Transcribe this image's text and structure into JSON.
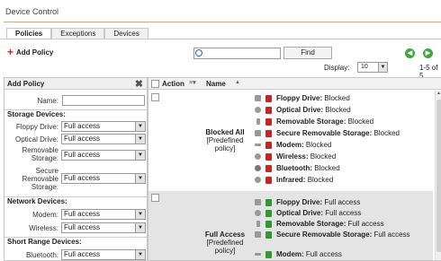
{
  "window": {
    "title": "Device Control"
  },
  "tabs": [
    {
      "label": "Policies",
      "active": true
    },
    {
      "label": "Exceptions"
    },
    {
      "label": "Devices"
    }
  ],
  "toolbar": {
    "add_policy_label": "Add Policy",
    "search_value": "",
    "find_label": "Find",
    "display_label": "Display:",
    "display_value": "10",
    "pager_text": "1-5 of 5"
  },
  "add_policy_panel": {
    "title": "Add Policy",
    "name_label": "Name:",
    "name_value": "",
    "storage_title": "Storage Devices:",
    "network_title": "Network Devices:",
    "short_range_title": "Short Range Devices:",
    "fields": [
      {
        "label": "Floppy Drive:",
        "value": "Full access"
      },
      {
        "label": "Optical Drive:",
        "value": "Full access"
      },
      {
        "label": "Removable Storage:",
        "value": "Full access"
      },
      {
        "label": "Secure Removable Storage:",
        "value": "Full access"
      },
      {
        "label": "Modem:",
        "value": "Full access"
      },
      {
        "label": "Wireless:",
        "value": "Full access"
      },
      {
        "label": "Bluetooth:",
        "value": "Full access"
      }
    ]
  },
  "table": {
    "headers": {
      "action": "Action",
      "name": "Name"
    },
    "rows": [
      {
        "name": "Blocked All",
        "subtitle": "[Predefined policy]",
        "devices": [
          {
            "name": "Floppy Drive:",
            "status": "Blocked"
          },
          {
            "name": "Optical Drive:",
            "status": "Blocked"
          },
          {
            "name": "Removable Storage:",
            "status": "Blocked"
          },
          {
            "name": "Secure Removable Storage:",
            "status": "Blocked"
          },
          {
            "name": "Modem:",
            "status": "Blocked"
          },
          {
            "name": "Wireless:",
            "status": "Blocked"
          },
          {
            "name": "Bluetooth:",
            "status": "Blocked"
          },
          {
            "name": "Infrared:",
            "status": "Blocked"
          }
        ]
      },
      {
        "name": "Full Access",
        "subtitle": "[Predefined policy]",
        "devices": [
          {
            "name": "Floppy Drive:",
            "status": "Full access"
          },
          {
            "name": "Optical Drive:",
            "status": "Full access"
          },
          {
            "name": "Removable Storage:",
            "status": "Full access"
          },
          {
            "name": "Secure Removable Storage:",
            "status": "Full access"
          },
          {
            "name": "Modem:",
            "status": "Full access"
          }
        ]
      }
    ]
  },
  "colors": {
    "accent": "#f0a45a",
    "blocked": "#cc2222",
    "allowed": "#2e9a2e",
    "nav": "#3fa83f"
  }
}
